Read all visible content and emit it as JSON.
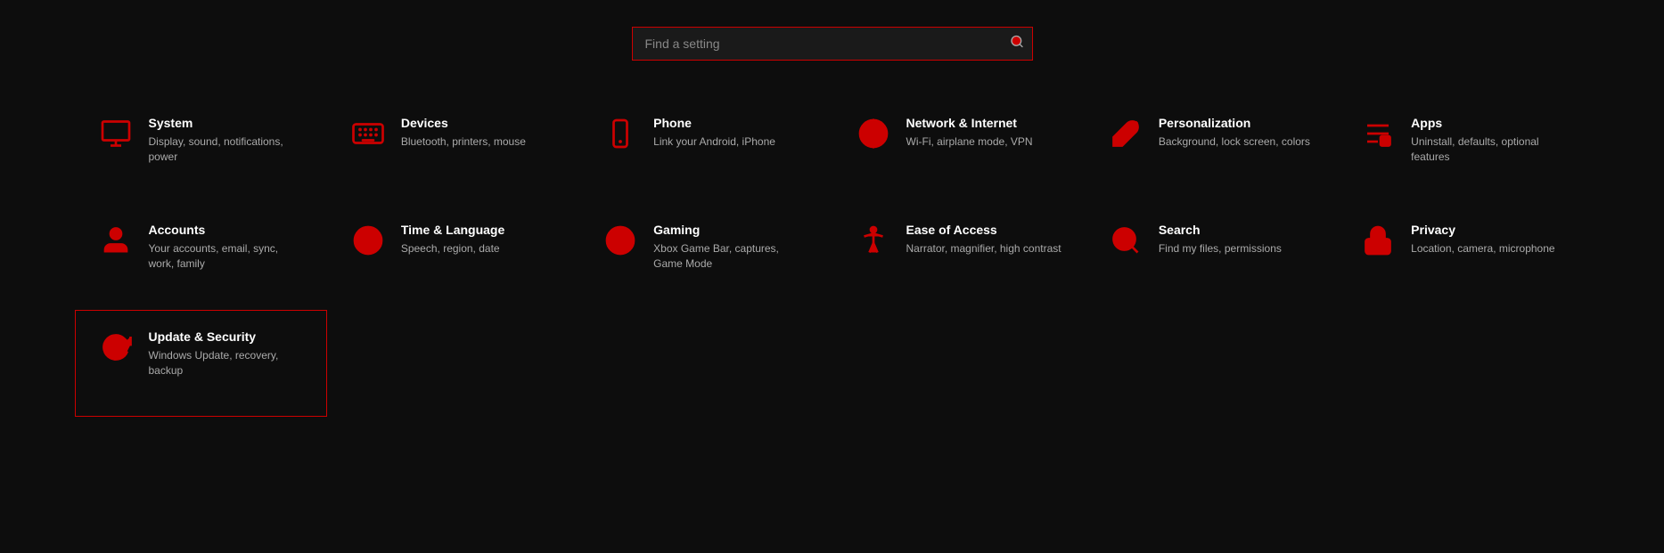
{
  "search": {
    "placeholder": "Find a setting",
    "icon": "search-icon"
  },
  "settings": [
    {
      "id": "system",
      "title": "System",
      "desc": "Display, sound, notifications, power",
      "icon": "monitor",
      "selected": false
    },
    {
      "id": "devices",
      "title": "Devices",
      "desc": "Bluetooth, printers, mouse",
      "icon": "keyboard",
      "selected": false
    },
    {
      "id": "phone",
      "title": "Phone",
      "desc": "Link your Android, iPhone",
      "icon": "phone",
      "selected": false
    },
    {
      "id": "network",
      "title": "Network & Internet",
      "desc": "Wi-Fi, airplane mode, VPN",
      "icon": "globe",
      "selected": false
    },
    {
      "id": "personalization",
      "title": "Personalization",
      "desc": "Background, lock screen, colors",
      "icon": "brush",
      "selected": false
    },
    {
      "id": "apps",
      "title": "Apps",
      "desc": "Uninstall, defaults, optional features",
      "icon": "apps",
      "selected": false
    },
    {
      "id": "accounts",
      "title": "Accounts",
      "desc": "Your accounts, email, sync, work, family",
      "icon": "person",
      "selected": false
    },
    {
      "id": "time",
      "title": "Time & Language",
      "desc": "Speech, region, date",
      "icon": "clock",
      "selected": false
    },
    {
      "id": "gaming",
      "title": "Gaming",
      "desc": "Xbox Game Bar, captures, Game Mode",
      "icon": "controller",
      "selected": false
    },
    {
      "id": "ease",
      "title": "Ease of Access",
      "desc": "Narrator, magnifier, high contrast",
      "icon": "accessibility",
      "selected": false
    },
    {
      "id": "search",
      "title": "Search",
      "desc": "Find my files, permissions",
      "icon": "search",
      "selected": false
    },
    {
      "id": "privacy",
      "title": "Privacy",
      "desc": "Location, camera, microphone",
      "icon": "lock",
      "selected": false
    },
    {
      "id": "update",
      "title": "Update & Security",
      "desc": "Windows Update, recovery, backup",
      "icon": "refresh",
      "selected": true
    }
  ]
}
